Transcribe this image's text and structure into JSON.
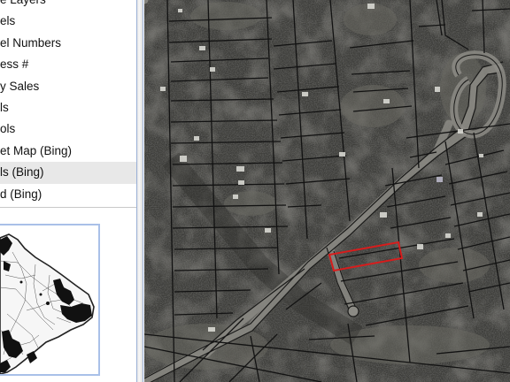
{
  "layers_panel": {
    "items": [
      {
        "label": "e Layers",
        "selected": false
      },
      {
        "label": "els",
        "selected": false
      },
      {
        "label": "el Numbers",
        "selected": false
      },
      {
        "label": "ess #",
        "selected": false
      },
      {
        "label": "y Sales",
        "selected": false
      },
      {
        "label": "ls",
        "selected": false
      },
      {
        "label": "ols",
        "selected": false
      },
      {
        "label": "et Map (Bing)",
        "selected": false
      },
      {
        "label": "ls (Bing)",
        "selected": true
      },
      {
        "label": "d (Bing)",
        "selected": false
      }
    ]
  },
  "colors": {
    "selection_highlight": "#e8e8e8",
    "overview_border": "#a9c0e8",
    "parcel_lines": "#111111",
    "selected_parcel": "#d81c1c",
    "imagery_base": "#3c3c39"
  }
}
